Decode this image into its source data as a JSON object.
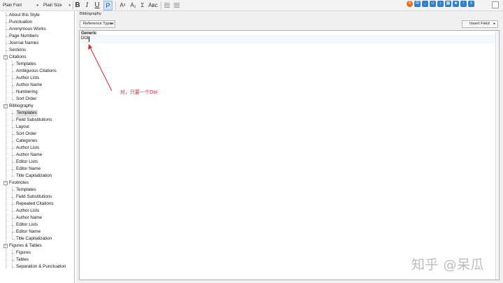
{
  "toolbar": {
    "font_select": "Plain Font",
    "size_select": "Plain Size",
    "bold": "B",
    "italic": "I",
    "underline": "U",
    "plain": "P",
    "superscript": "A¹",
    "subscript": "A₁",
    "sigma": "Σ",
    "small_caps": "Aʙc"
  },
  "tree": {
    "items": [
      {
        "label": "About this Style"
      },
      {
        "label": "Punctuation"
      },
      {
        "label": "Anonymous Works"
      },
      {
        "label": "Page Numbers"
      },
      {
        "label": "Journal Names"
      },
      {
        "label": "Sections"
      },
      {
        "label": "Citations",
        "expanded": true,
        "children": [
          "Templates",
          "Ambiguous Citations",
          "Author Lists",
          "Author Name",
          "Numbering",
          "Sort Order"
        ]
      },
      {
        "label": "Bibliography",
        "expanded": true,
        "children": [
          "Templates",
          "Field Substitutions",
          "Layout",
          "Sort Order",
          "Categories",
          "Author Lists",
          "Author Name",
          "Editor Lists",
          "Editor Name",
          "Title Capitalization"
        ]
      },
      {
        "label": "Footnotes",
        "expanded": true,
        "children": [
          "Templates",
          "Field Substitutions",
          "Repeated Citations",
          "Author Lists",
          "Author Name",
          "Editor Lists",
          "Editor Name",
          "Title Capitalization"
        ]
      },
      {
        "label": "Figures & Tables",
        "expanded": true,
        "children": [
          "Figures",
          "Tables",
          "Separation & Punctuation"
        ]
      }
    ]
  },
  "panel": {
    "title": "Bibliography",
    "reference_types_button": "Reference Types",
    "insert_field_button": "Insert Field",
    "editor": {
      "template_heading": "Generic",
      "template_line": "DOI"
    }
  },
  "annotation": {
    "text": "对，只要一个Doi",
    "color": "#e0262c"
  },
  "watermark": "知乎 @呆瓜"
}
